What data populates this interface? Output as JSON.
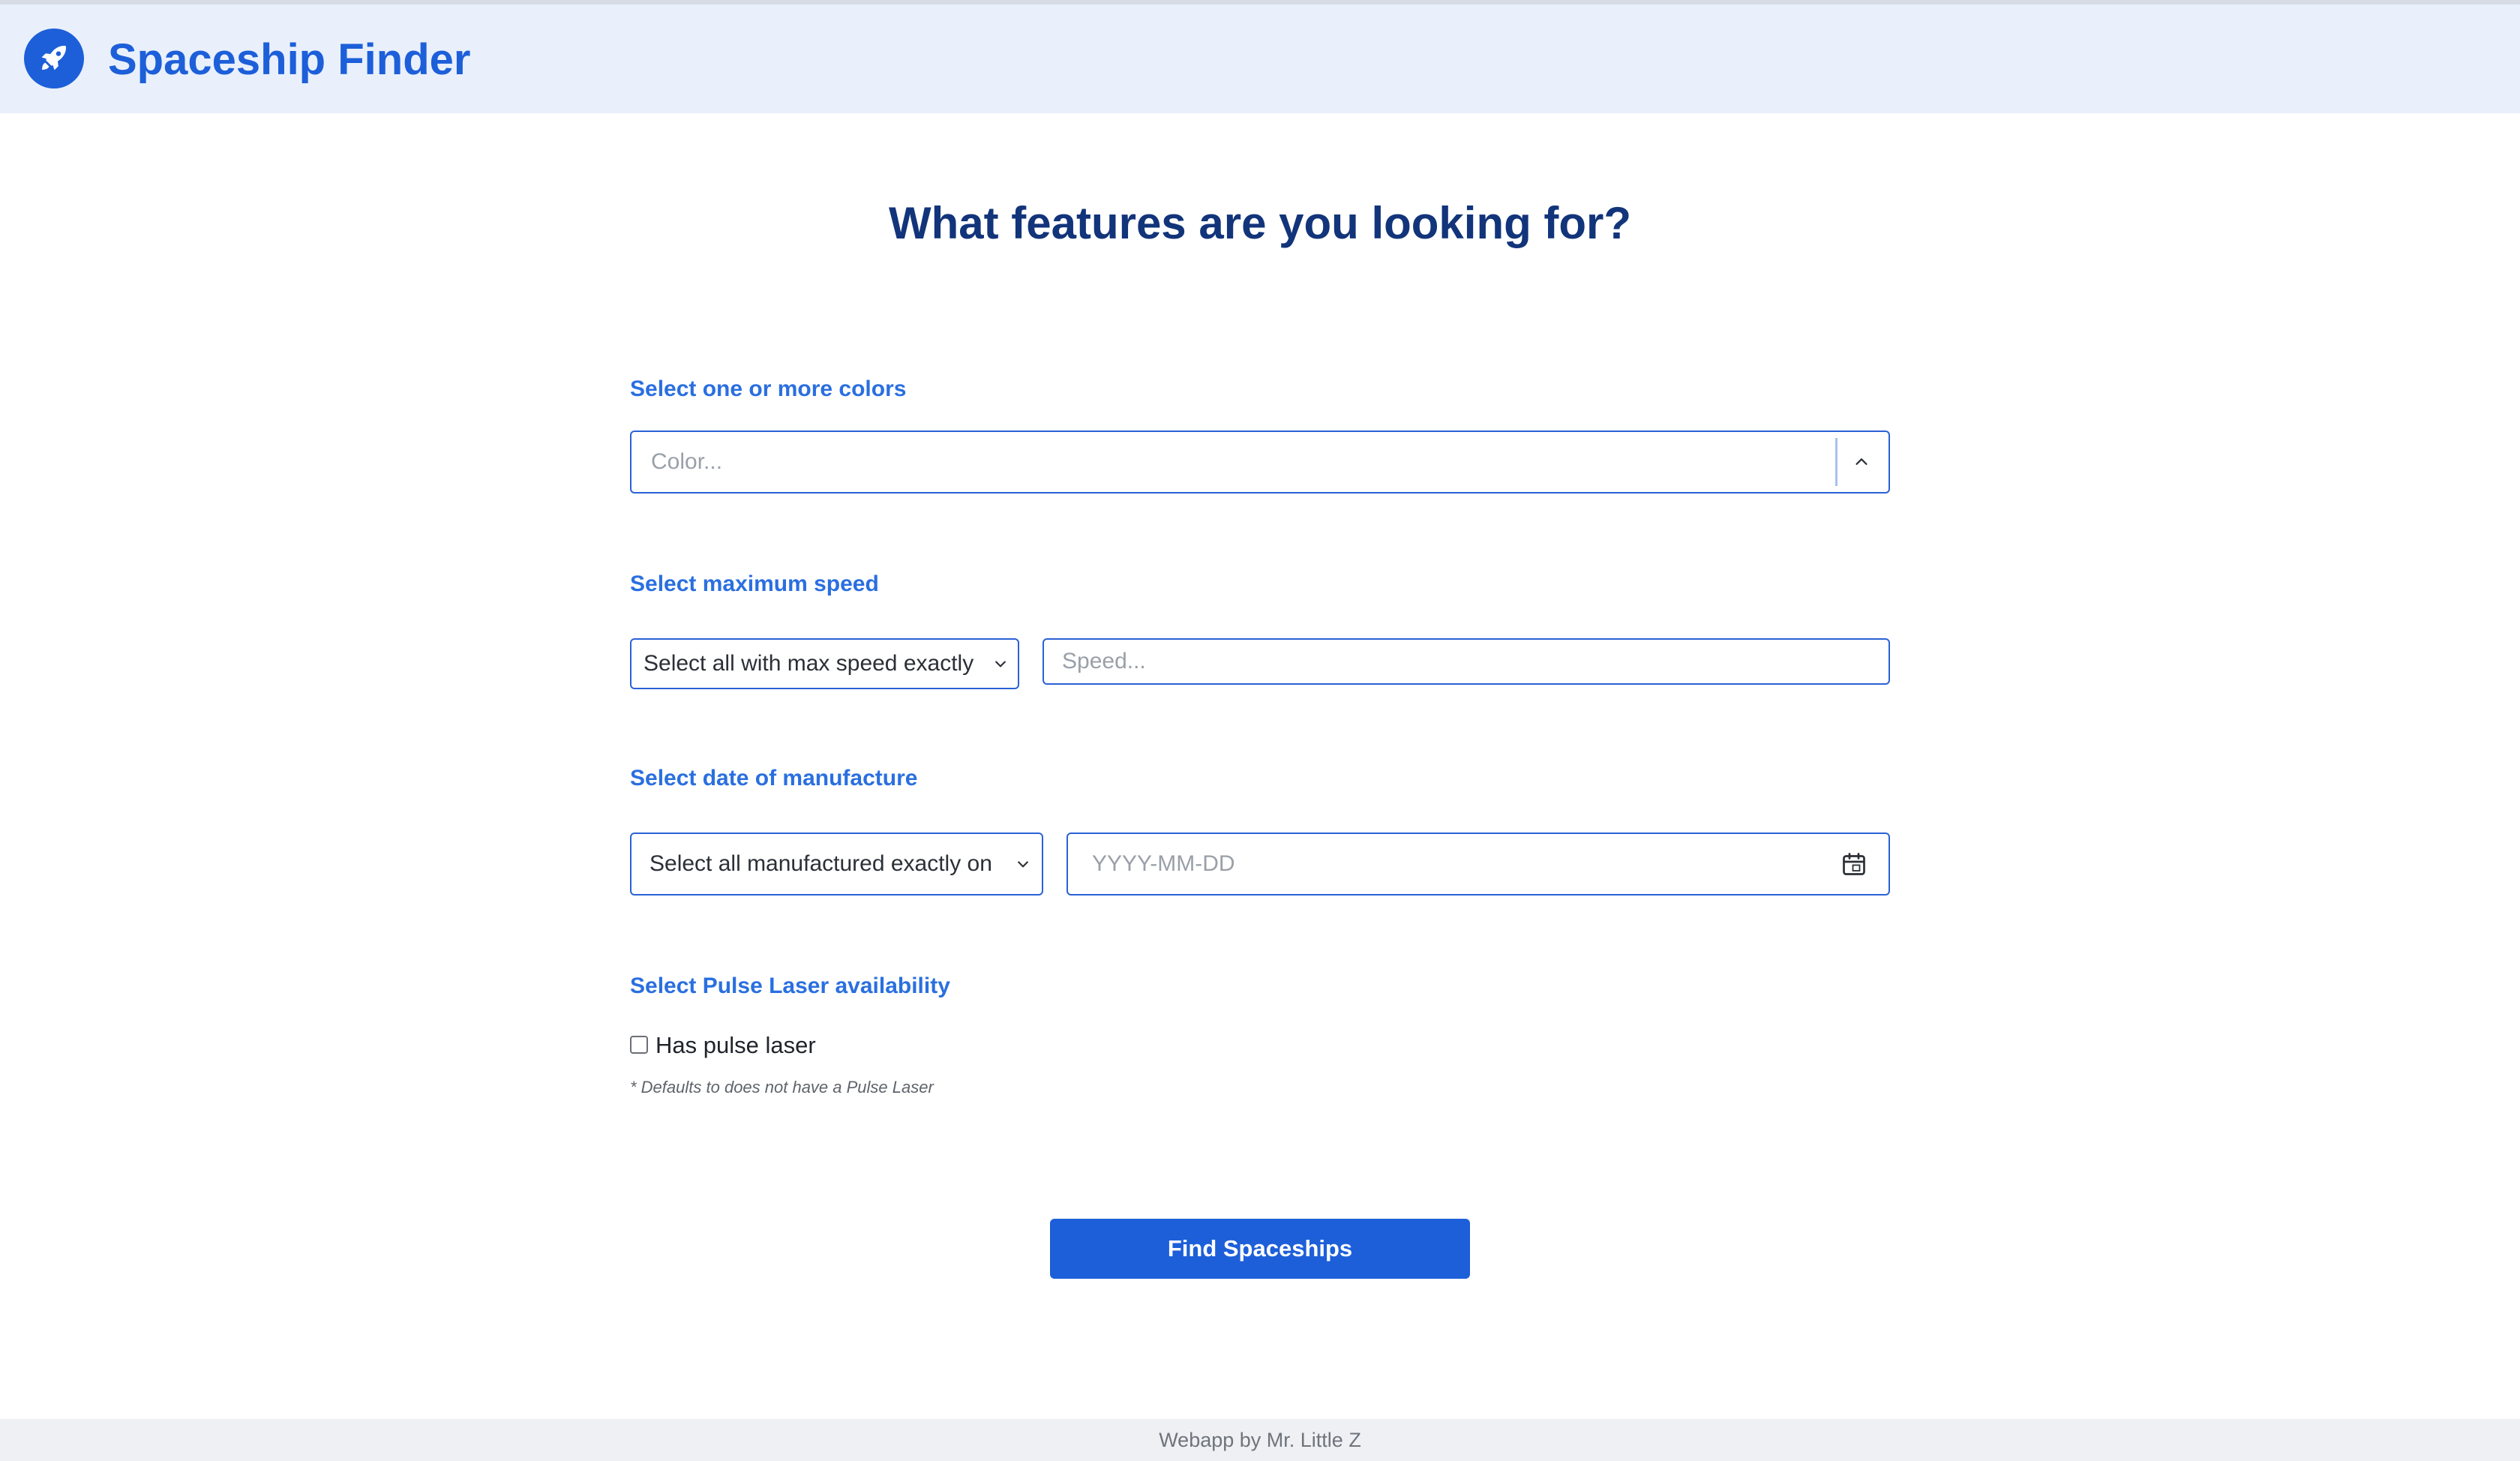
{
  "header": {
    "brand": "Spaceship Finder",
    "logo_icon": "rocket-icon",
    "brand_color": "#1d5fd9",
    "background_color": "#e9f0fc"
  },
  "main": {
    "title": "What features are you looking for?",
    "colors": {
      "label": "Select one or more colors",
      "placeholder": "Color...",
      "toggle_icon": "chevron-up-icon"
    },
    "speed": {
      "label": "Select maximum speed",
      "mode_selected": "Select all with max speed exactly",
      "placeholder": "Speed..."
    },
    "date": {
      "label": "Select date of manufacture",
      "mode_selected": "Select all manufactured exactly on",
      "placeholder": "YYYY-MM-DD",
      "calendar_icon": "calendar-icon"
    },
    "pulse_laser": {
      "label": "Select Pulse Laser availability",
      "checkbox_label": "Has pulse laser",
      "checked": false,
      "hint": "* Defaults to does not have a Pulse Laser"
    },
    "submit_label": "Find Spaceships",
    "accent_color": "#1d5fd9"
  },
  "footer": {
    "text": "Webapp by Mr. Little Z"
  }
}
